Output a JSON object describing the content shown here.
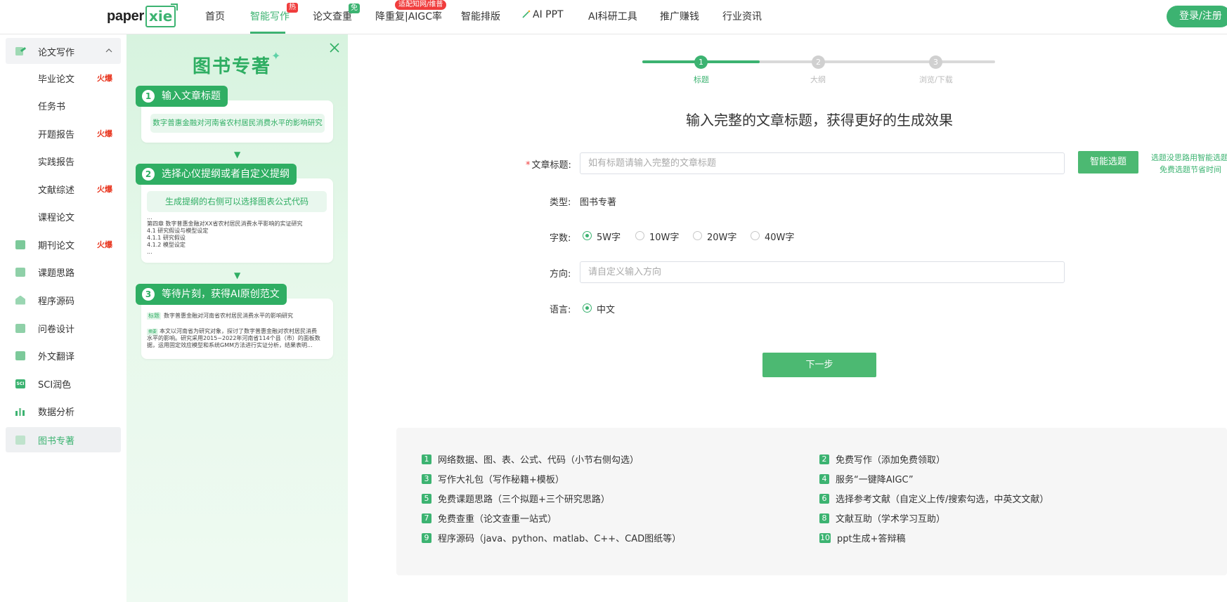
{
  "header": {
    "logo_main": "paper",
    "logo_box": "xie",
    "nav": [
      {
        "label": "首页"
      },
      {
        "label": "智能写作",
        "badge": "热"
      },
      {
        "label": "论文查重",
        "badge": "免"
      },
      {
        "label": "降重复|AIGC率",
        "badge": "适配知网/维普"
      },
      {
        "label": "智能排版"
      },
      {
        "label": "AI PPT"
      },
      {
        "label": "AI科研工具"
      },
      {
        "label": "推广赚钱"
      },
      {
        "label": "行业资讯"
      }
    ],
    "login": "登录/注册"
  },
  "sidebar": {
    "section": "论文写作",
    "hot_label": "火爆",
    "items": [
      {
        "label": "毕业论文",
        "hot": true
      },
      {
        "label": "任务书",
        "hot": false
      },
      {
        "label": "开题报告",
        "hot": true
      },
      {
        "label": "实践报告",
        "hot": false
      },
      {
        "label": "文献综述",
        "hot": true
      },
      {
        "label": "课程论文",
        "hot": false
      },
      {
        "label": "期刊论文",
        "hot": true
      },
      {
        "label": "课题思路",
        "hot": false
      },
      {
        "label": "程序源码",
        "hot": false
      },
      {
        "label": "问卷设计",
        "hot": false
      },
      {
        "label": "外文翻译",
        "hot": false
      },
      {
        "label": "SCI润色",
        "hot": false
      },
      {
        "label": "数据分析",
        "hot": false
      },
      {
        "label": "图书专著",
        "hot": false,
        "active": true
      }
    ],
    "sci_icon_text": "SCI"
  },
  "guide": {
    "title": "图书专著",
    "steps": [
      {
        "num": "1",
        "label": "输入文章标题",
        "content": "数字普惠金融对河南省农村居民消费水平的影响研究"
      },
      {
        "num": "2",
        "label": "选择心仪提纲或者自定义提纲",
        "content": "生成提纲的右侧可以选择图表公式代码",
        "outline": [
          "...",
          "第四章 数字普惠金融对XX省农村居民消费水平影响的实证研究",
          "4.1 研究假设与模型设定",
          "4.1.1 研究假设",
          "4.1.2 模型设定",
          "..."
        ]
      },
      {
        "num": "3",
        "label": "等待片刻，获得AI原创范文",
        "tag_title": "标题",
        "title_text": "数字普惠金融对河南省农村居民消费水平的影响研究",
        "tag_abstract": "摘要",
        "abstract_lines": [
          "本文以河南省为研究对象，探讨了数字普惠金融对农村居民消费",
          "水平的影响。研究采用2015~2022年河南省114个县（市）的面板数",
          "据，运用固定效应模型和系统GMM方法进行实证分析，结果表明..."
        ]
      }
    ]
  },
  "progress": {
    "steps": [
      {
        "num": "1",
        "label": "标题"
      },
      {
        "num": "2",
        "label": "大纲"
      },
      {
        "num": "3",
        "label": "浏览/下载"
      }
    ]
  },
  "form": {
    "heading": "输入完整的文章标题，获得更好的生成效果",
    "title_label": "文章标题:",
    "title_placeholder": "如有标题请输入完整的文章标题",
    "smart_btn": "智能选题",
    "hint_line1": "选题没思路用智能选题",
    "hint_line2": "免费选题节省时间",
    "type_label": "类型:",
    "type_value": "图书专著",
    "words_label": "字数:",
    "word_options": [
      "5W字",
      "10W字",
      "20W字",
      "40W字"
    ],
    "word_selected": "5W字",
    "direction_label": "方向:",
    "direction_placeholder": "请自定义输入方向",
    "lang_label": "语言:",
    "lang_value": "中文",
    "next_btn": "下一步"
  },
  "benefits": [
    {
      "num": "1",
      "text": "网络数据、图、表、公式、代码（小节右侧勾选）"
    },
    {
      "num": "2",
      "text": "免费写作（添加免费领取）"
    },
    {
      "num": "3",
      "text": "写作大礼包（写作秘籍+模板）"
    },
    {
      "num": "4",
      "text": "服务“一键降AIGC”"
    },
    {
      "num": "5",
      "text": "免费课题思路（三个拟题+三个研究思路）"
    },
    {
      "num": "6",
      "text": "选择参考文献（自定义上传/搜索勾选，中英文文献）"
    },
    {
      "num": "7",
      "text": "免费查重（论文查重一站式）"
    },
    {
      "num": "8",
      "text": "文献互助（学术学习互助）"
    },
    {
      "num": "9",
      "text": "程序源码（java、python、matlab、C++、CAD图纸等）"
    },
    {
      "num": "10",
      "text": "ppt生成+答辩稿"
    }
  ],
  "colors": {
    "accent": "#3cb371",
    "hot": "#e8331c",
    "badge_red": "#f03d3d"
  }
}
